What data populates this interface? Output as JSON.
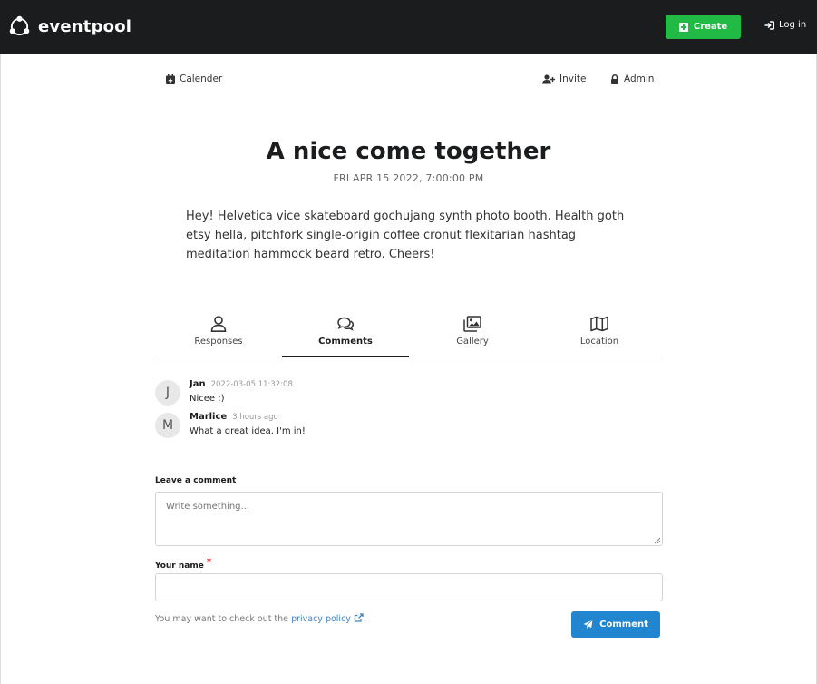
{
  "header": {
    "brand": "eventpool",
    "create_label": "Create",
    "login_label": "Log in",
    "icons": {
      "brand": "network-logo-icon",
      "create": "plus-square-icon",
      "login": "sign-in-icon"
    }
  },
  "submenu": {
    "calendar_label": "Calender",
    "invite_label": "Invite",
    "admin_label": "Admin"
  },
  "event": {
    "title": "A nice come together",
    "datetime": "FRI APR 15 2022, 7:00:00 PM",
    "description": "Hey! Helvetica vice skateboard gochujang synth photo booth. Health goth etsy hella, pitchfork single-origin coffee cronut flexitarian hashtag meditation hammock beard retro. Cheers!"
  },
  "tabs": [
    {
      "label": "Responses",
      "icon": "user-icon"
    },
    {
      "label": "Comments",
      "icon": "comments-icon",
      "active": true
    },
    {
      "label": "Gallery",
      "icon": "images-icon"
    },
    {
      "label": "Location",
      "icon": "map-icon"
    }
  ],
  "comments": [
    {
      "initial": "J",
      "author": "Jan",
      "time": "2022-03-05 11:32:08",
      "text": "Nicee :)"
    },
    {
      "initial": "M",
      "author": "Marlice",
      "time": "3 hours ago",
      "text": "What a great idea. I'm in!"
    }
  ],
  "form": {
    "comment_label": "Leave a comment",
    "comment_placeholder": "Write something...",
    "name_label": "Your name",
    "required_mark": "*",
    "hint_prefix": "You may want to check out the ",
    "hint_link": "privacy policy",
    "hint_suffix": ".",
    "submit_label": "Comment"
  },
  "colors": {
    "topbar": "#1b1c1d",
    "create_button": "#21ba45",
    "comment_button": "#2185d0",
    "link": "#4183c4"
  }
}
